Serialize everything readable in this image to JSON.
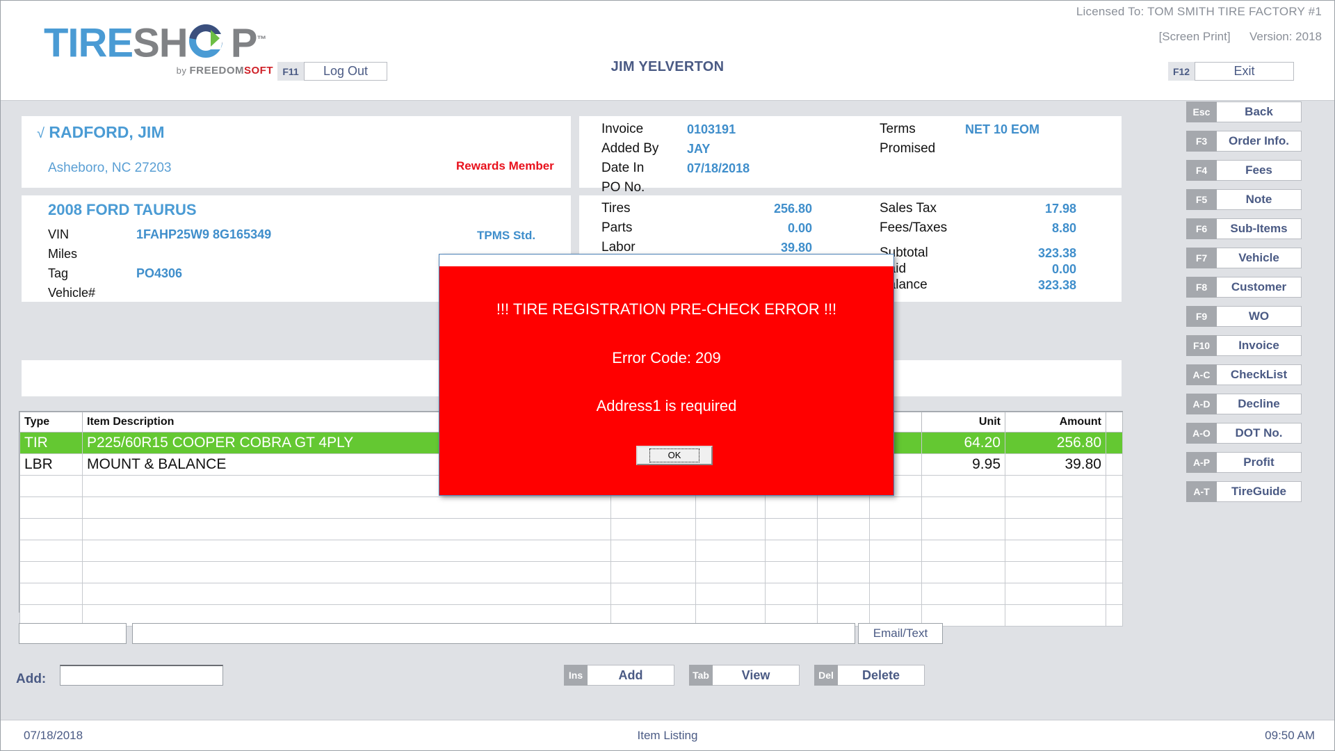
{
  "header": {
    "licensed_to": "Licensed To: TOM SMITH TIRE FACTORY #1",
    "screen_print": "[Screen Print]",
    "version": "Version: 2018",
    "logo": {
      "part1": "TIRE",
      "part2": "SH",
      "part3": "P",
      "tm": "™",
      "byline_by": "by ",
      "byline_freedom": "FREEDOM",
      "byline_soft": "SOFT"
    },
    "logout": {
      "key": "F11",
      "label": "Log Out"
    },
    "user_name": "JIM YELVERTON",
    "exit": {
      "key": "F12",
      "label": "Exit"
    }
  },
  "sidebar": {
    "buttons": [
      {
        "key": "Esc",
        "label": "Back"
      },
      {
        "key": "F3",
        "label": "Order Info."
      },
      {
        "key": "F4",
        "label": "Fees"
      },
      {
        "key": "F5",
        "label": "Note"
      },
      {
        "key": "F6",
        "label": "Sub-Items"
      },
      {
        "key": "F7",
        "label": "Vehicle"
      },
      {
        "key": "F8",
        "label": "Customer"
      },
      {
        "key": "F9",
        "label": "WO"
      },
      {
        "key": "F10",
        "label": "Invoice"
      },
      {
        "key": "A-C",
        "label": "CheckList"
      },
      {
        "key": "A-D",
        "label": "Decline"
      },
      {
        "key": "A-O",
        "label": "DOT No."
      },
      {
        "key": "A-P",
        "label": "Profit"
      },
      {
        "key": "A-T",
        "label": "TireGuide"
      }
    ]
  },
  "customer": {
    "check": "√",
    "name": "RADFORD, JIM",
    "address": "Asheboro, NC  27203",
    "rewards": "Rewards Member"
  },
  "vehicle": {
    "title": "2008 FORD TAURUS",
    "vin_label": "VIN",
    "vin_value": "1FAHP25W9  8G165349",
    "miles_label": "Miles",
    "miles_value": "",
    "tag_label": "Tag",
    "tag_value": "PO4306",
    "vehnum_label": "Vehicle#",
    "vehnum_value": "",
    "tpms": "TPMS Std."
  },
  "invoice": {
    "invoice_label": "Invoice",
    "invoice_value": "0103191",
    "addedby_label": "Added By",
    "addedby_value": "JAY",
    "datein_label": "Date In",
    "datein_value": "07/18/2018",
    "pono_label": "PO No.",
    "pono_value": "",
    "terms_label": "Terms",
    "terms_value": "NET 10 EOM",
    "promised_label": "Promised",
    "promised_value": ""
  },
  "totals": {
    "tires_label": "Tires",
    "tires_value": "256.80",
    "parts_label": "Parts",
    "parts_value": "0.00",
    "labor_label": "Labor",
    "labor_value": "39.80",
    "salestax_label": "Sales Tax",
    "salestax_value": "17.98",
    "feestaxes_label": "Fees/Taxes",
    "feestaxes_value": "8.80",
    "subtotal_label": "Subtotal",
    "subtotal_value": "323.38",
    "paid_label": "Paid",
    "paid_value": "0.00",
    "balance_label": "Balance",
    "balance_value": "323.38"
  },
  "grid": {
    "columns": [
      "Type",
      "Item Description",
      "",
      "",
      "",
      "",
      "",
      "Unit",
      "Amount",
      ""
    ],
    "rows": [
      {
        "selected": true,
        "cells": [
          "TIR",
          "P225/60R15   COOPER COBRA GT  4PLY",
          "",
          "",
          "",
          "",
          "",
          "64.20",
          "256.80",
          ""
        ]
      },
      {
        "selected": false,
        "cells": [
          "LBR",
          "MOUNT & BALANCE",
          "",
          "",
          "",
          "",
          "",
          "9.95",
          "39.80",
          ""
        ]
      }
    ],
    "empty_row_count": 7
  },
  "notes_row": {
    "email_text_label": "Email/Text",
    "box1_value": "",
    "box2_value": ""
  },
  "add_row": {
    "label": "Add:",
    "input_value": "",
    "buttons": [
      {
        "key": "Ins",
        "label": "Add"
      },
      {
        "key": "Tab",
        "label": "View"
      },
      {
        "key": "Del",
        "label": "Delete"
      }
    ]
  },
  "statusbar": {
    "date": "07/18/2018",
    "center": "Item Listing",
    "time": "09:50 AM"
  },
  "dialog": {
    "title": "",
    "line1": "!!! TIRE REGISTRATION PRE-CHECK ERROR !!!",
    "line2": "Error Code: 209",
    "line3": "Address1 is required",
    "ok_label": "OK",
    "bg_color": "#ff0000"
  }
}
